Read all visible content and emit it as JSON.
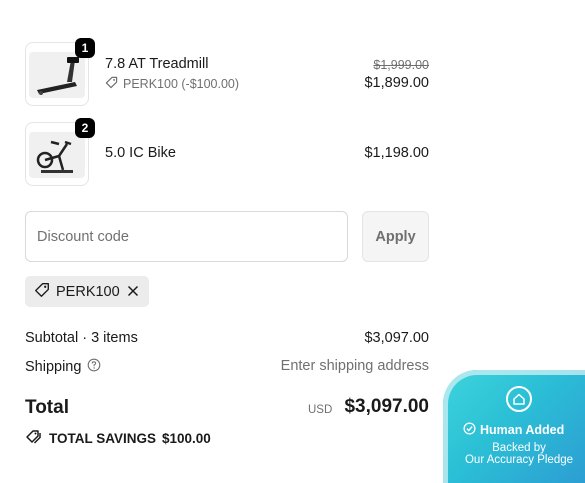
{
  "items": [
    {
      "quantity": "1",
      "name": "7.8 AT Treadmill",
      "discount_label": "PERK100 (-$100.00)",
      "original_price": "$1,999.00",
      "price": "$1,899.00",
      "image_icon": "treadmill-image"
    },
    {
      "quantity": "2",
      "name": "5.0 IC Bike",
      "price": "$1,198.00",
      "image_icon": "exercise-bike-image"
    }
  ],
  "discount": {
    "placeholder": "Discount code",
    "apply_label": "Apply",
    "applied_code": "PERK100"
  },
  "summary": {
    "subtotal_label": "Subtotal · 3 items",
    "subtotal_value": "$3,097.00",
    "shipping_label": "Shipping",
    "shipping_value": "Enter shipping address",
    "total_label": "Total",
    "currency": "USD",
    "total_value": "$3,097.00",
    "savings_label": "TOTAL SAVINGS",
    "savings_value": "$100.00"
  },
  "pledge": {
    "title": "Human Added",
    "line1": "Backed by",
    "line2": "Our Accuracy Pledge",
    "gradient_start": "#3fd4dc",
    "gradient_end": "#2d97d2"
  }
}
